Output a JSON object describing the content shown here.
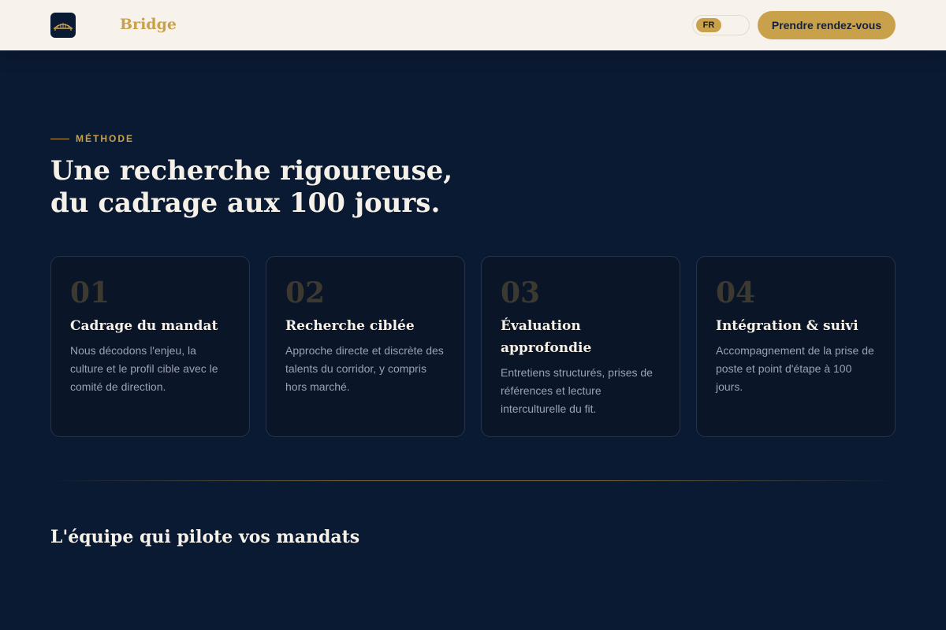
{
  "header": {
    "brand": "Bridge",
    "logo_icon": "bridge-icon",
    "language": "FR",
    "cta_label": "Prendre rendez-vous"
  },
  "colors": {
    "accent": "#c9a14a",
    "background": "#0b1a33",
    "header_bg": "#f7f3ec",
    "card_bg": "#0a1528"
  },
  "method": {
    "eyebrow": "MÉTHODE",
    "title_line1": "Une recherche rigoureuse,",
    "title_line2": "du cadrage aux 100 jours.",
    "steps": [
      {
        "number": "01",
        "title": "Cadrage du mandat",
        "description": "Nous décodons l'enjeu, la culture et le profil cible avec le comité de direction."
      },
      {
        "number": "02",
        "title": "Recherche ciblée",
        "description": "Approche directe et discrète des talents du corridor, y compris hors marché."
      },
      {
        "number": "03",
        "title": "Évaluation approfondie",
        "description": "Entretiens structurés, prises de références et lecture interculturelle du fit."
      },
      {
        "number": "04",
        "title": "Intégration & suivi",
        "description": "Accompagnement de la prise de poste et point d'étape à 100 jours."
      }
    ]
  },
  "team": {
    "title": "L'équipe qui pilote vos mandats"
  }
}
